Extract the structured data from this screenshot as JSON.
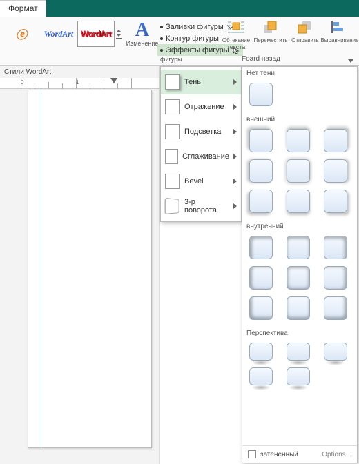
{
  "tab": {
    "format": "Формат"
  },
  "wordart": {
    "label1": "ⓔ",
    "label2": "WordArt",
    "label3": "WordArt"
  },
  "bigA": {
    "glyph": "A",
    "caption": "Изменение"
  },
  "shape_menu": {
    "fill": "Заливки фигуры",
    "outline": "Контур фигуры",
    "effects": "Эффекты фигуры"
  },
  "ribbon_groups": {
    "shapes_caption": "фигуры",
    "text_caption": "текста"
  },
  "ribbon_right": {
    "wrap": "Обтекание",
    "move": "Переместить",
    "send": "Отправить",
    "align": "Выравнивание",
    "foard": "Foard назад"
  },
  "styles_panel": "Стили WordArt",
  "ruler": {
    "n1": "0",
    "n2": "1"
  },
  "fx": {
    "shadow": "Тень",
    "reflection": "Отражение",
    "glow": "Подсветка",
    "soft": "Сглаживание",
    "bevel": "Bevel",
    "rot3d": "3-р поворота"
  },
  "shadow_gallery": {
    "none": "Нет тени",
    "outer": "внешний",
    "inner": "внутренний",
    "perspective": "Перспектива",
    "footer_label": "затененный",
    "options": "Options..."
  }
}
